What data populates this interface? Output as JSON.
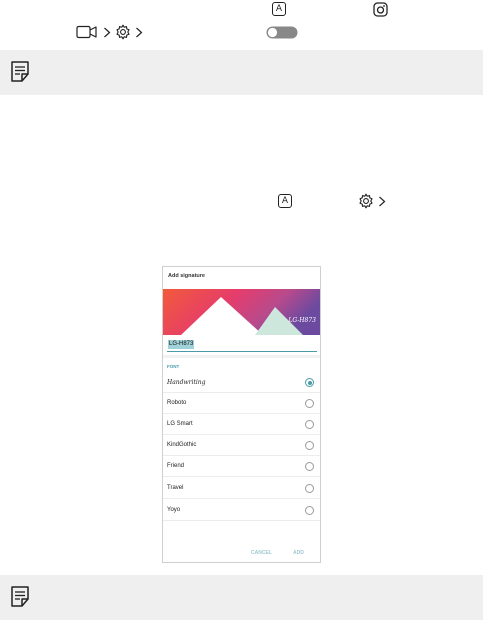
{
  "top": {
    "keycap_a_label": "A",
    "keycap_a2_label": "A"
  },
  "phone": {
    "dialog_title": "Add signature",
    "banner_signature": "LG-H873",
    "name_value": "LG-H873",
    "font_section_label": "FONT",
    "fonts": [
      {
        "label": "Handwriting",
        "selected": true
      },
      {
        "label": "Roboto",
        "selected": false
      },
      {
        "label": "LG Smart",
        "selected": false
      },
      {
        "label": "KindGothic",
        "selected": false
      },
      {
        "label": "Friend",
        "selected": false
      },
      {
        "label": "Travel",
        "selected": false
      },
      {
        "label": "Yoyo",
        "selected": false
      }
    ],
    "cancel_label": "CANCEL",
    "add_label": "ADD",
    "accent_color": "#4a9aa8"
  },
  "icons": {
    "keycap": "keycap-a-icon",
    "camera": "camera-icon",
    "instagram": "camera-lens-icon",
    "video": "video-camera-icon",
    "gear": "gear-icon",
    "chevron": "chevron-right-icon",
    "toggle": "toggle-switch-icon",
    "note": "note-icon"
  }
}
